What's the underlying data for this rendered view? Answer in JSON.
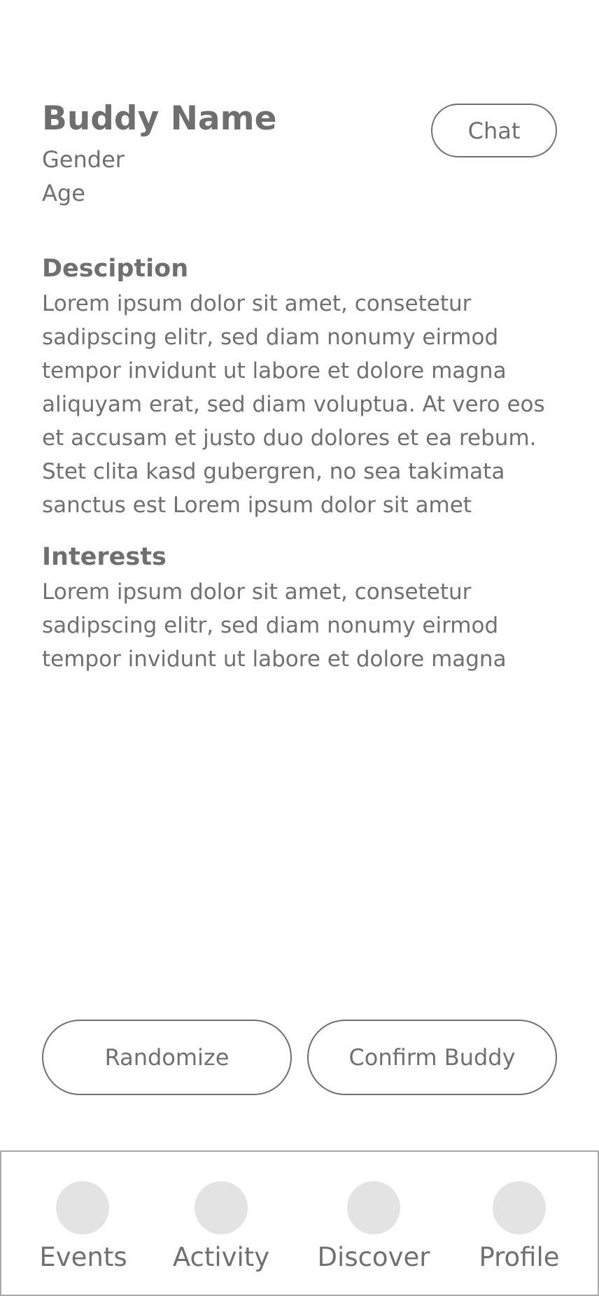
{
  "profile": {
    "name": "Buddy Name",
    "gender": "Gender",
    "age": "Age"
  },
  "chat_button": {
    "label": "Chat"
  },
  "description": {
    "heading": "Desciption",
    "lines": [
      "Lorem ipsum dolor sit amet, consetetur",
      "sadipscing elitr, sed diam nonumy eirmod",
      "tempor invidunt ut labore et dolore magna",
      "aliquyam erat, sed diam voluptua. At vero eos",
      "et accusam et justo duo dolores et ea rebum.",
      "Stet clita kasd gubergren, no sea takimata",
      "sanctus est Lorem ipsum dolor sit amet"
    ]
  },
  "interests": {
    "heading": "Interests",
    "lines": [
      "Lorem ipsum dolor sit amet, consetetur",
      "sadipscing elitr, sed diam nonumy eirmod",
      "tempor invidunt ut labore et dolore magna"
    ]
  },
  "actions": {
    "randomize_label": "Randomize",
    "confirm_label": "Confirm Buddy"
  },
  "bottom_nav": {
    "items": [
      {
        "label": "Events",
        "icon": "events-icon"
      },
      {
        "label": "Activity",
        "icon": "activity-icon"
      },
      {
        "label": "Discover",
        "icon": "discover-icon"
      },
      {
        "label": "Profile",
        "icon": "profile-icon"
      }
    ]
  },
  "colors": {
    "text": "#707070",
    "border": "#6f6f6f",
    "nav_border": "#a9a9a9",
    "icon_placeholder": "#e3e3e3",
    "background": "#ffffff"
  }
}
